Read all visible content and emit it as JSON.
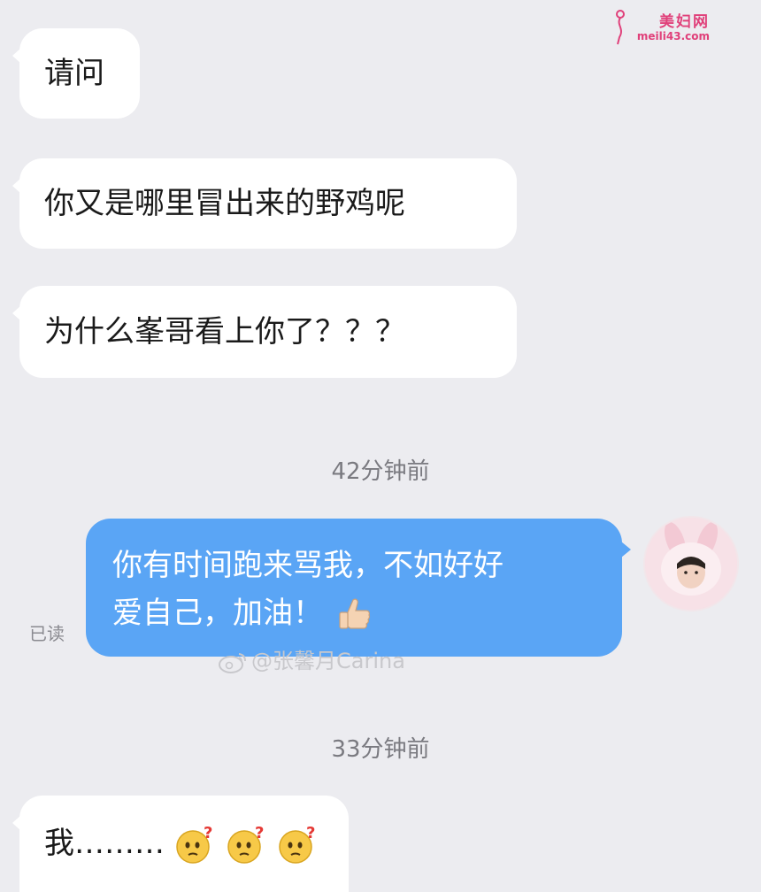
{
  "watermark": {
    "site_title": "美妇网",
    "site_url": "meili43.com"
  },
  "messages": [
    {
      "side": "left",
      "text": "请问"
    },
    {
      "side": "left",
      "text": "你又是哪里冒出来的野鸡呢"
    },
    {
      "side": "left",
      "text": "为什么峯哥看上你了？？？"
    }
  ],
  "timestamps": [
    "42分钟前",
    "33分钟前"
  ],
  "reply": {
    "line1": "你有时间跑来骂我，不如好好",
    "line2": "爱自己，加油！",
    "emoji": "thumbs-up",
    "read_status": "已读",
    "bubble_color": "#5aa5f5"
  },
  "weibo_watermark": "@张馨月Carina",
  "last_message": {
    "text": "我………",
    "emojis": [
      "confused-face",
      "confused-face",
      "confused-face"
    ]
  },
  "colors": {
    "background": "#ececf0",
    "incoming_bubble": "#ffffff",
    "outgoing_bubble": "#5aa5f5",
    "watermark_pink": "#e0407a"
  }
}
